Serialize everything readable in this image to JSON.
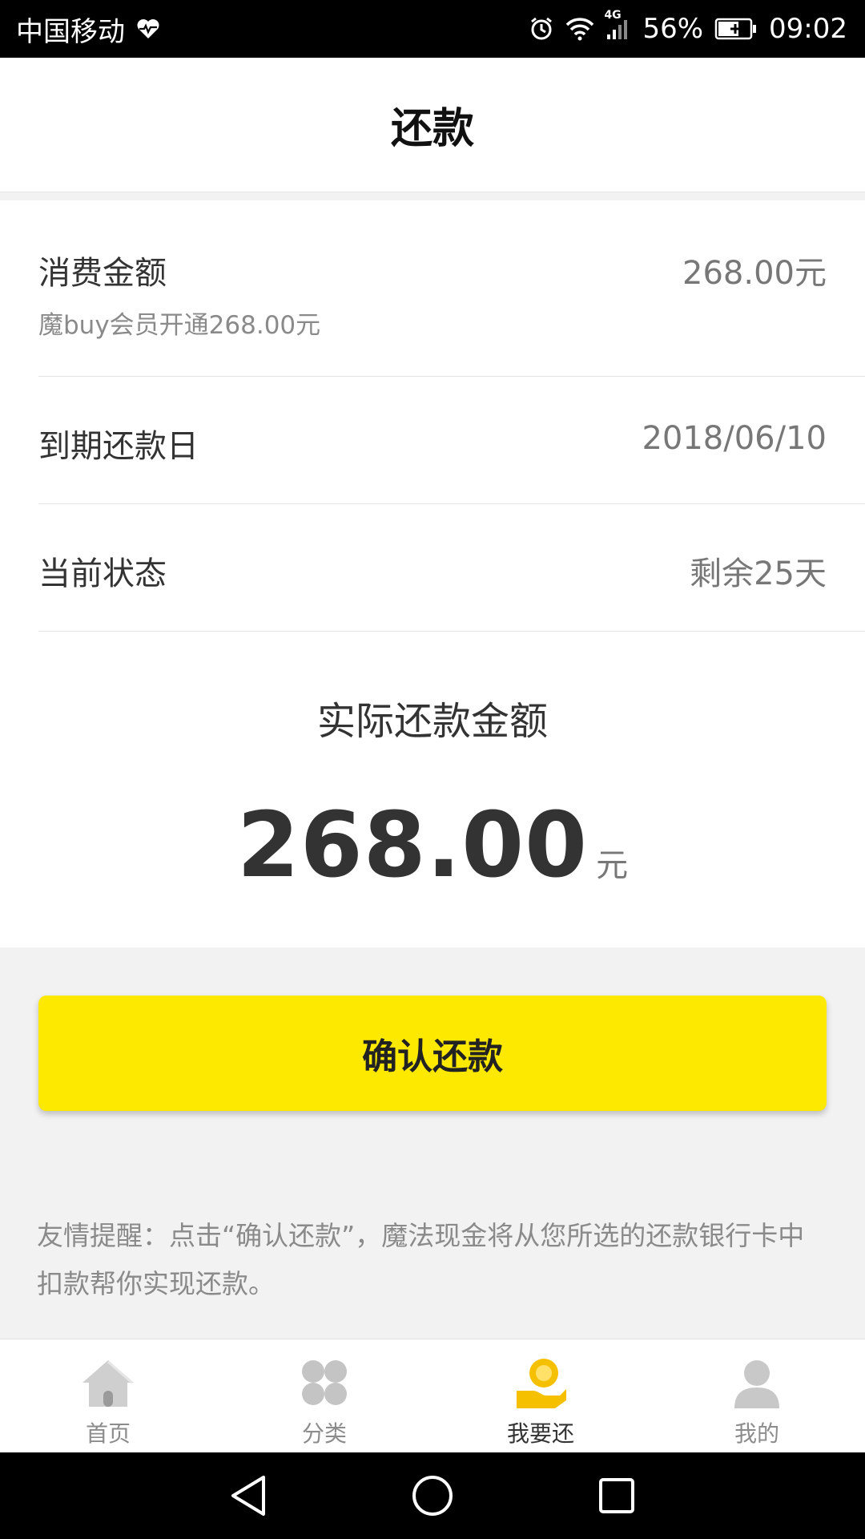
{
  "status_bar": {
    "carrier": "中国移动",
    "network": "4G",
    "battery": "56%",
    "time": "09:02"
  },
  "header": {
    "title": "还款"
  },
  "details": {
    "consume_label": "消费金额",
    "consume_value": "268.00元",
    "consume_desc": "魔buy会员开通268.00元",
    "due_label": "到期还款日",
    "due_value": "2018/06/10",
    "status_label": "当前状态",
    "status_value": "剩余25天"
  },
  "actual": {
    "title": "实际还款金额",
    "amount": "268.00",
    "unit": "元"
  },
  "confirm_button": {
    "label": "确认还款"
  },
  "tip": {
    "text": "友情提醒：点击“确认还款”，魔法现金将从您所选的还款银行卡中扣款帮你实现还款。"
  },
  "bottom_nav": {
    "items": [
      {
        "label": "首页",
        "icon": "home-icon"
      },
      {
        "label": "分类",
        "icon": "category-icon"
      },
      {
        "label": "我要还",
        "icon": "repay-icon",
        "active": true
      },
      {
        "label": "我的",
        "icon": "profile-icon"
      }
    ]
  },
  "colors": {
    "accent": "#fde800",
    "active_icon": "#f5c000",
    "inactive_icon": "#c4c4c4"
  }
}
